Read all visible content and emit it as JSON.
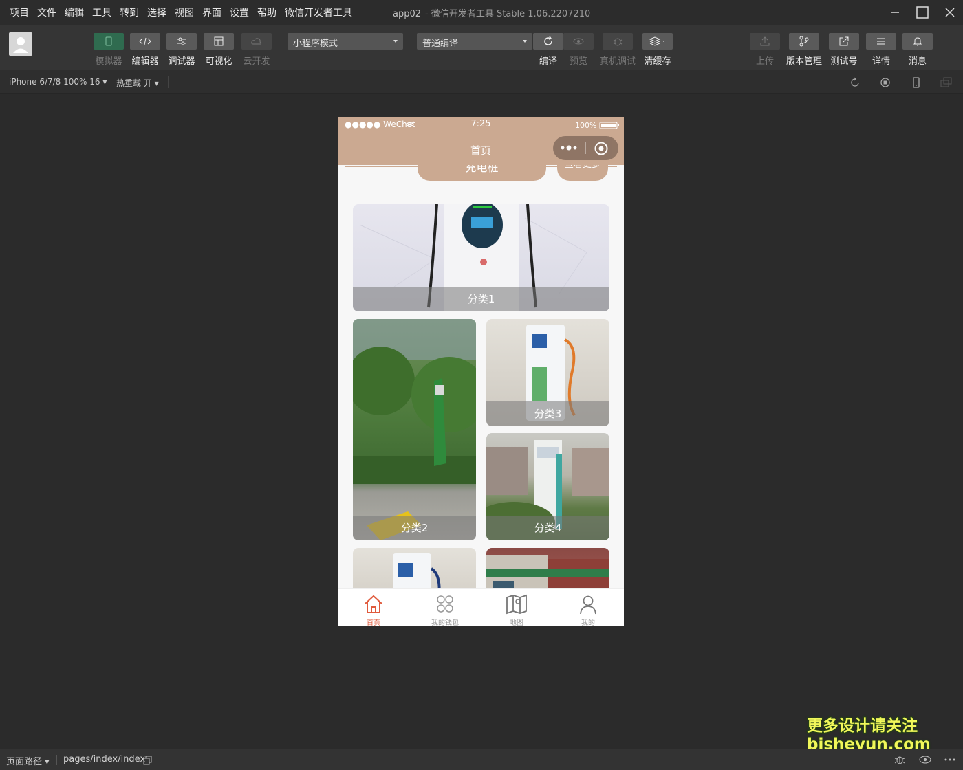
{
  "menubar": {
    "items": [
      "项目",
      "文件",
      "编辑",
      "工具",
      "转到",
      "选择",
      "视图",
      "界面",
      "设置",
      "帮助",
      "微信开发者工具"
    ],
    "app_name": "app02",
    "window_title": "- 微信开发者工具 Stable 1.06.2207210"
  },
  "toolbar": {
    "simulator": "模拟器",
    "editor": "编辑器",
    "debugger": "调试器",
    "visualize": "可视化",
    "cloud": "云开发",
    "mode_select": "小程序模式",
    "compile_select": "普通编译",
    "compile": "编译",
    "preview": "预览",
    "real_debug": "真机调试",
    "clear_cache": "清缓存",
    "upload": "上传",
    "version": "版本管理",
    "test_account": "测试号",
    "details": "详情",
    "messages": "消息"
  },
  "subbar": {
    "device": "iPhone 6/7/8 100% 16 ▾",
    "hot_reload": "热重载 开 ▾"
  },
  "phone": {
    "status": {
      "signal": "●●●●● WeChat",
      "time": "7:25",
      "battery": "100%"
    },
    "nav_title": "首页",
    "top_buttons": {
      "charge": "充电桩",
      "more": "查看更多"
    },
    "cards": [
      {
        "caption": "分类1"
      },
      {
        "caption": "分类2"
      },
      {
        "caption": "分类3"
      },
      {
        "caption": "分类4"
      }
    ],
    "tabbar": [
      {
        "label": "首页",
        "active": true
      },
      {
        "label": "我的钱包",
        "active": false
      },
      {
        "label": "地图",
        "active": false
      },
      {
        "label": "我的",
        "active": false
      }
    ]
  },
  "bottombar": {
    "page_path_label": "页面路径 ▾",
    "page_path": "pages/index/index"
  },
  "watermark": {
    "line1": "更多设计请关注",
    "line2": "bisheyun.com"
  },
  "colors": {
    "theme": "#cba991",
    "active_tab": "#e05a3c",
    "ide_bg": "#2b2b2b"
  }
}
